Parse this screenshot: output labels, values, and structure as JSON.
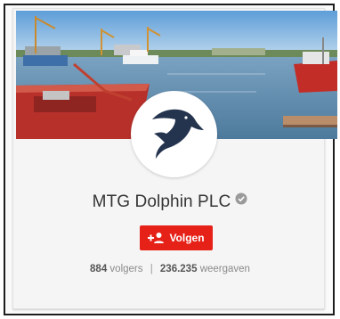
{
  "channel": {
    "name": "MTG Dolphin PLC",
    "verified_icon": "verified-badge-icon"
  },
  "subscribe_button": {
    "label": "Volgen",
    "icon": "add-person-icon",
    "color": "#e62117"
  },
  "stats": {
    "followers_count": "884",
    "followers_label": "volgers",
    "separator": "|",
    "views_count": "236.235",
    "views_label": "weergaven"
  },
  "banner": {
    "description_icon": "harbor-photo"
  },
  "avatar": {
    "icon": "dolphin-logo-icon",
    "color": "#24344f"
  }
}
